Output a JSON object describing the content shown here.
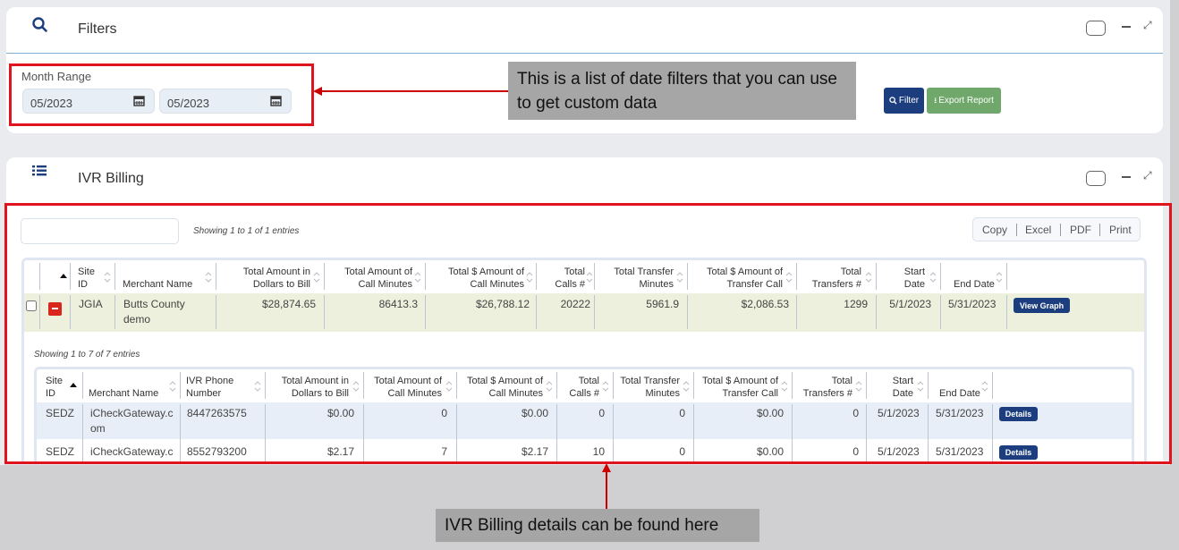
{
  "filters": {
    "title": "Filters",
    "month_range_label": "Month Range",
    "from_value": "05/2023",
    "to_value": "05/2023",
    "filter_button": "Filter",
    "export_button": "Export Report"
  },
  "callouts": {
    "filters_note": "This is a list of date filters that you can use to get custom data",
    "billing_note": "IVR Billing details can be found here"
  },
  "ivr_billing": {
    "title": "IVR Billing",
    "search_placeholder": "",
    "showing_text": "Showing 1 to 1 of 1 entries",
    "toolbar": [
      "Copy",
      "Excel",
      "PDF",
      "Print"
    ],
    "columns": {
      "site_id": "Site ID",
      "merchant": "Merchant Name",
      "total_amount": "Total Amount in Dollars to Bill",
      "total_call_minutes": "Total Amount of Call Minutes",
      "total_dollar_call_minutes": "Total $ Amount of Call Minutes",
      "total_calls": "Total Calls #",
      "total_transfer_minutes": "Total Transfer Minutes",
      "total_dollar_transfer": "Total $ Amount of Transfer Call",
      "total_transfers": "Total Transfers #",
      "start_date": "Start Date",
      "end_date": "End Date"
    },
    "row": {
      "site_id": "JGIA",
      "merchant": "Butts County demo",
      "total_amount": "$28,874.65",
      "total_call_minutes": "86413.3",
      "total_dollar_call_minutes": "$26,788.12",
      "total_calls": "20222",
      "total_transfer_minutes": "5961.9",
      "total_dollar_transfer": "$2,086.53",
      "total_transfers": "1299",
      "start_date": "5/1/2023",
      "end_date": "5/31/2023",
      "action": "View Graph"
    },
    "sub": {
      "showing_text": "Showing 1 to 7 of 7 entries",
      "columns": {
        "site_id": "Site ID",
        "merchant": "Merchant Name",
        "phone": "IVR Phone Number",
        "total_amount": "Total Amount in Dollars to Bill",
        "total_call_minutes": "Total Amount of Call Minutes",
        "total_dollar_call_minutes": "Total $ Amount of Call Minutes",
        "total_calls": "Total Calls #",
        "total_transfer_minutes": "Total Transfer Minutes",
        "total_dollar_transfer": "Total $ Amount of Transfer Call",
        "total_transfers": "Total Transfers #",
        "start_date": "Start Date",
        "end_date": "End Date"
      },
      "rows": [
        {
          "site_id": "SEDZ",
          "merchant": "iCheckGateway.com",
          "phone": "8447263575",
          "total_amount": "$0.00",
          "total_call_minutes": "0",
          "total_dollar_call_minutes": "$0.00",
          "total_calls": "0",
          "total_transfer_minutes": "0",
          "total_dollar_transfer": "$0.00",
          "total_transfers": "0",
          "start_date": "5/1/2023",
          "end_date": "5/31/2023",
          "action": "Details"
        },
        {
          "site_id": "SEDZ",
          "merchant": "iCheckGateway.c",
          "phone": "8552793200",
          "total_amount": "$2.17",
          "total_call_minutes": "7",
          "total_dollar_call_minutes": "$2.17",
          "total_calls": "10",
          "total_transfer_minutes": "0",
          "total_dollar_transfer": "$0.00",
          "total_transfers": "0",
          "start_date": "5/1/2023",
          "end_date": "5/31/2023",
          "action": "Details"
        }
      ]
    }
  },
  "colors": {
    "accent": "#1c3e7e",
    "export": "#6fa86a",
    "highlight_row": "#edf0dc",
    "callout_bg": "#a6a6a6",
    "annotation_red": "#e0141e"
  }
}
